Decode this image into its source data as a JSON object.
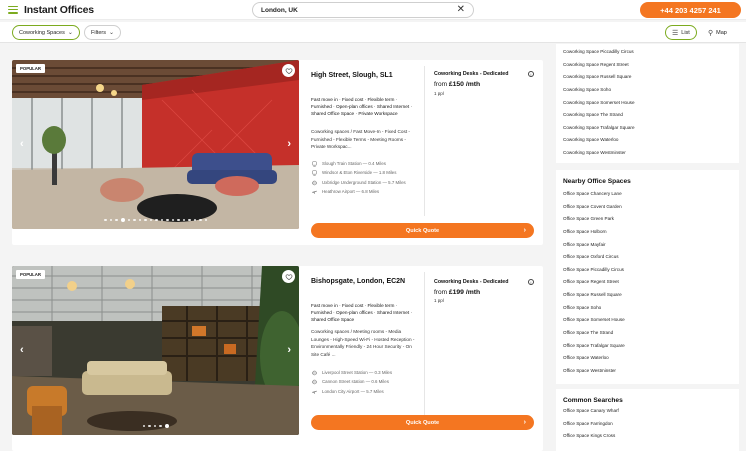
{
  "header": {
    "logo": "Instant Offices",
    "search_value": "London, UK",
    "phone": "+44 203 4257 241"
  },
  "toolbar": {
    "space_type": "Coworking Spaces",
    "filters": "Filters",
    "list": "List",
    "map": "Map"
  },
  "listings": [
    {
      "badge": "POPULAR",
      "title": "High Street, Slough, SL1",
      "price_type": "Coworking Desks - Dedicated",
      "price_prefix": "from",
      "price": "£150 /mth",
      "ppl": "1 ppl",
      "features": "Fast move in  ·  Fixed cost  ·  Flexible term  ·  Furnished  ·  Open-plan offices  ·  Shared Internet  ·  Shared Office Space  ·  Private Workspace",
      "description": "Coworking spaces / Fast Move-In - Fixed Cost - Furnished - Flexible Terms - Meeting Rooms - Private Workspac...",
      "transport": [
        {
          "icon": "train-icon",
          "name": "Slough Train Station",
          "distance": "0.4 Miles"
        },
        {
          "icon": "train-icon",
          "name": "Windsor & Eton Riverside",
          "distance": "1.8 Miles"
        },
        {
          "icon": "underground-icon",
          "name": "Uxbridge Underground Station",
          "distance": "5.7 Miles"
        },
        {
          "icon": "plane-icon",
          "name": "Heathrow Airport",
          "distance": "6.8 Miles"
        }
      ],
      "quote": "Quick Quote"
    },
    {
      "badge": "POPULAR",
      "title": "Bishopsgate, London, EC2N",
      "price_type": "Coworking Desks - Dedicated",
      "price_prefix": "from",
      "price": "£199 /mth",
      "ppl": "1 ppl",
      "features": "Fast move in  ·  Fixed cost  ·  Flexible term  ·  Furnished  ·  Open-plan offices  ·  Shared Internet  ·  Shared Office Space",
      "description": "Coworking spaces / Meeting rooms - Media Lounges - High-Speed Wi-Fi - Hosted Reception - Environmentally Friendly - 24 Hour Security - On Site Café ...",
      "transport": [
        {
          "icon": "underground-icon",
          "name": "Liverpool Street Station",
          "distance": "0.3 Miles"
        },
        {
          "icon": "underground-icon",
          "name": "Cannon Street station",
          "distance": "0.6 Miles"
        },
        {
          "icon": "plane-icon",
          "name": "London City Airport",
          "distance": "5.7 Miles"
        }
      ],
      "quote": "Quick Quote"
    }
  ],
  "sidebar": {
    "coworking_links": [
      "Coworking Space Piccadilly Circus",
      "Coworking Space Regent Street",
      "Coworking Space Russell Square",
      "Coworking Space Soho",
      "Coworking Space Somerset House",
      "Coworking Space The Strand",
      "Coworking Space Trafalgar Square",
      "Coworking Space Waterloo",
      "Coworking Space Westminster"
    ],
    "nearby_title": "Nearby Office Spaces",
    "nearby_links": [
      "Office Space Chancery Lane",
      "Office Space Covent Garden",
      "Office Space Green Park",
      "Office Space Holborn",
      "Office Space Mayfair",
      "Office Space Oxford Circus",
      "Office Space Piccadilly Circus",
      "Office Space Regent Street",
      "Office Space Russell Square",
      "Office Space Soho",
      "Office Space Somerset House",
      "Office Space The Strand",
      "Office Space Trafalgar Square",
      "Office Space Waterloo",
      "Office Space Westminster"
    ],
    "common_title": "Common Searches",
    "common_links": [
      "Office Space Canary Wharf",
      "Office Space Farringdon",
      "Office Space Kings Cross"
    ]
  },
  "colors": {
    "accent_green": "#7cab1f",
    "accent_orange": "#f47621"
  }
}
